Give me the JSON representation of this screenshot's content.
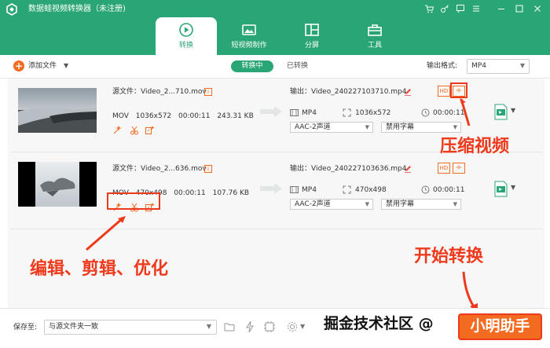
{
  "app": {
    "title": "数据蛙视频转换器（未注册)",
    "brand_color": "#2aa575",
    "accent_color": "#f26b21",
    "annotation_color": "#ee3a1c"
  },
  "window_controls": [
    "cart-icon",
    "key-icon",
    "feedback-icon",
    "menu-icon",
    "minimize-icon",
    "maximize-icon",
    "close-icon"
  ],
  "tabs": [
    {
      "label": "转换",
      "icon": "convert-icon",
      "active": true
    },
    {
      "label": "短视频制作",
      "icon": "short-video-icon",
      "active": false
    },
    {
      "label": "分屏",
      "icon": "split-screen-icon",
      "active": false
    },
    {
      "label": "工具",
      "icon": "toolbox-icon",
      "active": false
    }
  ],
  "toolbar": {
    "add_file": "添加文件",
    "converting": "转换中",
    "converted": "已转换",
    "output_format_label": "输出格式:",
    "output_format_value": "MP4"
  },
  "files": [
    {
      "source": "源文件：Video_2...710.mov",
      "format": "MOV",
      "resolution": "1036x572",
      "duration": "00:00:11",
      "size": "243.31 KB",
      "output_name": "输出：Video_240227103710.mp4",
      "out_format": "MP4",
      "out_resolution": "1036x572",
      "out_duration": "00:00:11",
      "audio": "AAC-2声道",
      "subtitle": "禁用字幕"
    },
    {
      "source": "源文件：Video_2...636.mov",
      "format": "MOV",
      "resolution": "470x498",
      "duration": "00:00:11",
      "size": "107.76 KB",
      "output_name": "输出：Video_240227103636.mp4",
      "out_format": "MP4",
      "out_resolution": "470x498",
      "out_duration": "00:00:11",
      "audio": "AAC-2声道",
      "subtitle": "禁用字幕"
    }
  ],
  "annotations": {
    "compress": "压缩视频",
    "edit": "编辑、剪辑、优化",
    "start": "开始转换"
  },
  "bottom": {
    "save_label": "保存至:",
    "save_path": "与源文件夹一致",
    "watermark": "掘金技术社区 @",
    "start_button": "小明助手"
  }
}
